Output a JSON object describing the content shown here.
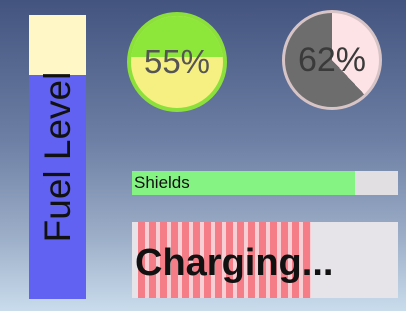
{
  "fuel": {
    "label": "Fuel Level",
    "level": 0.79,
    "fill_color": "#6262f2",
    "empty_color": "#fff8c6"
  },
  "gauge_fill": {
    "label": "55%",
    "value": 0.55,
    "fill_color": "#f6f083",
    "empty_color": "#8de73b",
    "ring_color": "#8be03a"
  },
  "gauge_pie": {
    "label": "62%",
    "value": 0.62,
    "fill_color": "#6d6d6d",
    "empty_color": "#fde3e6"
  },
  "shields": {
    "label": "Shields",
    "value": 0.84,
    "fill_color": "#84f384",
    "track_color": "#e2dfe3"
  },
  "charging": {
    "label": "Charging...",
    "value": 0.65,
    "stripe_color": "#f47d88"
  }
}
